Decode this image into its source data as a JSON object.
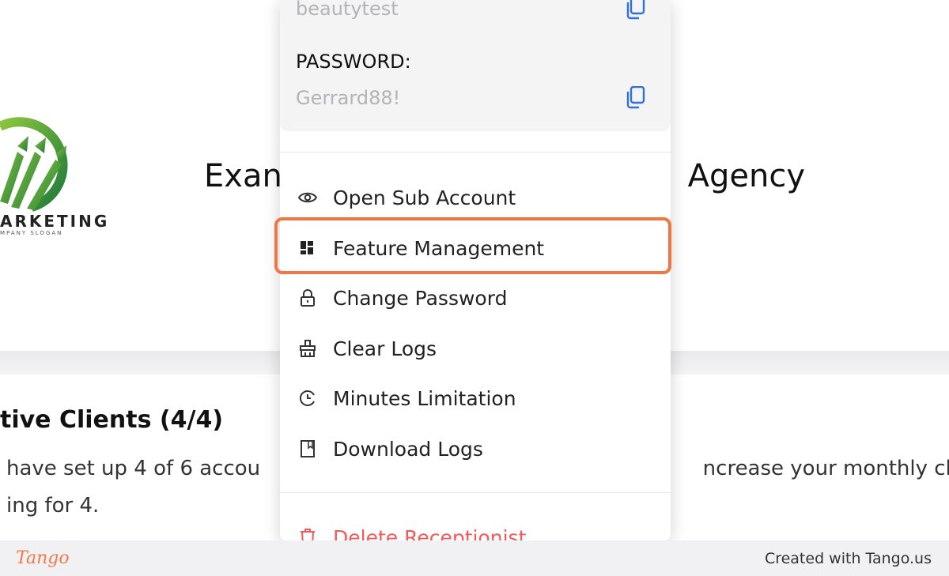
{
  "background": {
    "logo_word": "ARKETING",
    "logo_slogan": "MPANY SLOGAN",
    "agency_title_left": "Exan",
    "agency_title_right": "Agency",
    "clients_title": "tive Clients (4/4)",
    "clients_desc_line1_left": "have set up 4 of 6 accou",
    "clients_desc_line1_right": "ncrease your monthly cha",
    "clients_desc_line2": "ing for 4."
  },
  "menu": {
    "username_value": "beautytest",
    "password_label": "PASSWORD:",
    "password_value": "Gerrard88!",
    "items": [
      {
        "label": "Open Sub Account",
        "icon": "eye-icon"
      },
      {
        "label": "Feature Management",
        "icon": "dashboard-icon"
      },
      {
        "label": "Change Password",
        "icon": "lock-icon"
      },
      {
        "label": "Clear Logs",
        "icon": "broom-icon"
      },
      {
        "label": "Minutes Limitation",
        "icon": "clock-icon"
      },
      {
        "label": "Download Logs",
        "icon": "book-icon"
      },
      {
        "label": "Delete Receptionist",
        "icon": "trash-icon"
      }
    ],
    "highlighted_item": "Feature Management"
  },
  "footer": {
    "brand": "Tango",
    "credit": "Created with Tango.us"
  },
  "colors": {
    "highlight": "#f07645",
    "danger": "#f25a5a",
    "copy_icon": "#2f6fe4",
    "logo_green": "#3a9a3a"
  }
}
